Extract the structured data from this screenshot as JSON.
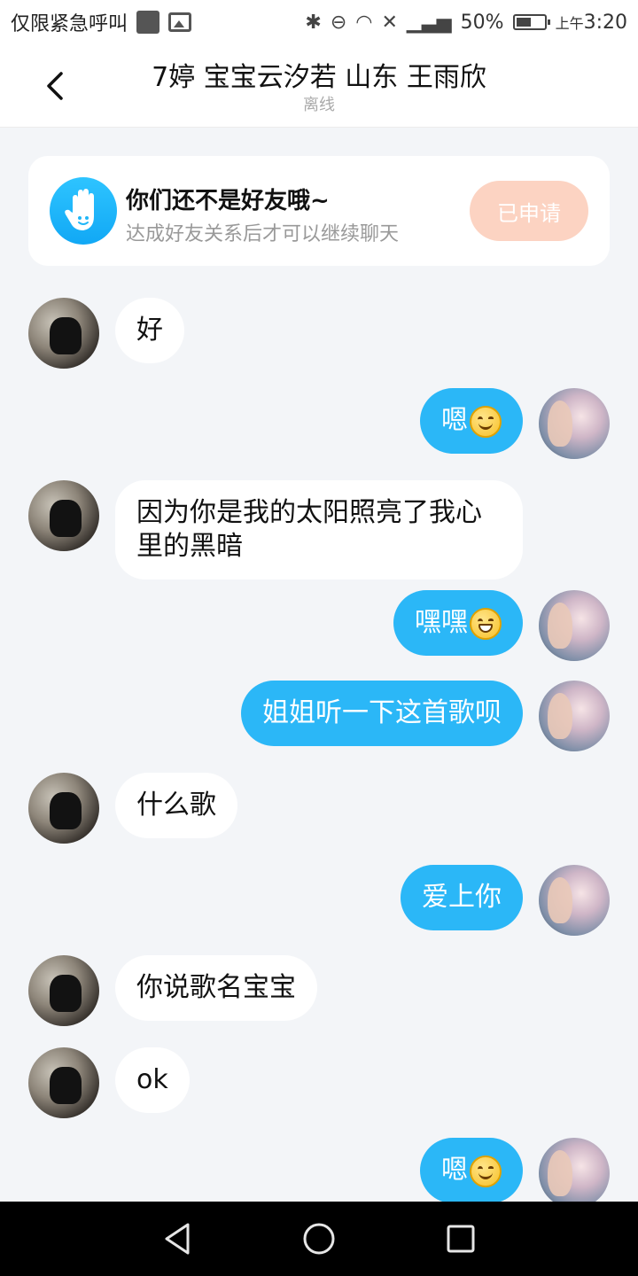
{
  "status_bar": {
    "left_text": "仅限紧急呼叫",
    "battery": "50%",
    "am_pm": "上午",
    "time": "3:20"
  },
  "header": {
    "back_icon": "chevron-left-icon",
    "title": "7婷 宝宝云汐若 山东 王雨欣",
    "subtitle": "离线"
  },
  "friend_card": {
    "icon": "waving-hand-icon",
    "title": "你们还不是好友哦~",
    "subtitle": "达成好友关系后才可以继续聊天",
    "button_label": "已申请",
    "colors": {
      "badge": "#1fb6f8",
      "button": "#fcd3c2"
    }
  },
  "messages": [
    {
      "side": "them",
      "text": "好"
    },
    {
      "side": "me",
      "text": "嗯",
      "emoji": "smile-emoji"
    },
    {
      "side": "them",
      "text": "因为你是我的太阳照亮了我心里的黑暗"
    },
    {
      "side": "me",
      "text": "嘿嘿",
      "emoji": "grin-emoji"
    },
    {
      "side": "me",
      "text": "姐姐听一下这首歌呗"
    },
    {
      "side": "them",
      "text": "什么歌"
    },
    {
      "side": "me",
      "text": "爱上你"
    },
    {
      "side": "them",
      "text": "你说歌名宝宝"
    },
    {
      "side": "them",
      "text": "ok"
    },
    {
      "side": "me",
      "text": "嗯",
      "emoji": "smile-emoji"
    }
  ],
  "colors": {
    "accent": "#2bb7f7",
    "background": "#f3f5f8"
  },
  "navbar": {
    "back": "triangle-back-icon",
    "home": "circle-home-icon",
    "recents": "square-recents-icon"
  }
}
